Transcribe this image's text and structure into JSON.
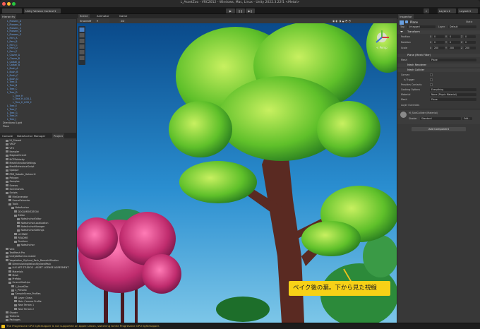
{
  "window": {
    "title": "L_AssetZoo - VRC2012 - Windows, Mac, Linux - Unity 2022.3.22f1 <Metal>"
  },
  "toolbar": {
    "account": "",
    "package": "Unity Version Control",
    "layers": "Layers",
    "layout": "Layout"
  },
  "hierarchy": {
    "tab": "Hierarchy",
    "items": [
      "L_Flowers_A",
      "L_Flowers_B",
      "L_Flowers_C",
      "L_Flowers_D",
      "L_Flowers_E",
      "L_Fern_A",
      "L_Fern_B",
      "L_Fern_C",
      "L_Fern_D",
      "L_Fern_E",
      "L_Clover_A",
      "L_Clover_B",
      "L_Cattail_A",
      "L_Cattail_B",
      "L_Bush_A",
      "L_Bush_B",
      "L_Bush_C",
      "L_Bush_D",
      "L_Tree_A",
      "L_Tree_B",
      "L_Tree_C",
      "L_Tree_D",
      "L_Tree_H",
      "L_Tree_H_LOD_1",
      "L_Tree_H_LOD_2",
      "L_Tree_E",
      "L_Tree_F",
      "L_Tree_G",
      "L_Tree_H",
      "L_Tree_I",
      "Directional Light",
      "Plane"
    ]
  },
  "project": {
    "tabs": [
      "Console",
      "NoteAnchor Manager",
      "Project"
    ],
    "items": [
      "UI_Shared",
      "VRCP",
      "VFX",
      "Kampler",
      "MagicalCircle2",
      "MCPFolderby",
      "MeshExtractorSettings",
      "MeshBehaviourScript",
      "Opaque",
      "PBR_Robotic_Hohenrill",
      "Polygon",
      "Samples",
      "Scenes",
      "Screenshots",
      "Scripts",
      "FileGenerator",
      "SceneExtractor",
      "Tools",
      "NoteAnchor",
      "DOCUMENTATION",
      "Editor",
      "NoteAnchorEditor",
      "NoteAnchorLocalization",
      "NoteAnchorManager",
      "NoteAnchorSettings",
      "LICENSE",
      "README",
      "Runtime",
      "NoteAnchor",
      "Vest",
      "TextMesh Pro",
      "UnityIbIBorkmo reader",
      "Vegetation_Stylized_Pack_BoosehiiStudios",
      "DimensionIngitationStyilseidPack",
      "LUX ART STUDIOS - ASSET LICENSE AGREEMENT",
      "Materials",
      "Mesh",
      "Prefabs",
      "ScreenShotUps",
      "L_AssetZoo",
      "L_Preview",
      "SampleScene_Profiles",
      "Layer_Grass",
      "Main Camera Profile",
      "New Terrain 1",
      "New Terrain 2",
      "Shader",
      "Textures",
      "Packages"
    ]
  },
  "scene": {
    "tabs": [
      "Scene",
      "Animator",
      "Game"
    ],
    "shading": "Shaded",
    "mode": "2D",
    "persp": "< Persp",
    "caption": "ベイク後の葉。下から見た視線"
  },
  "inspector": {
    "tabs": [
      "Inspector"
    ],
    "object_name": "Plane",
    "static": "Static",
    "tag_label": "Tag",
    "tag": "Untagged",
    "layer_label": "Layer",
    "layer": "Default",
    "transform": "Transform",
    "position": [
      "Position",
      "X",
      "0",
      "Y",
      "0",
      "Z",
      "0"
    ],
    "rotation": [
      "Rotation",
      "X",
      "0",
      "Y",
      "0",
      "Z",
      "0"
    ],
    "scale": [
      "Scale",
      "X",
      "200",
      "Y",
      "200",
      "Z",
      "200"
    ],
    "mesh_filter": "Plane (Mesh Filter)",
    "mesh_label": "Mesh",
    "mesh_value": "Plane",
    "mesh_renderer": "Mesh Renderer",
    "mesh_collider": "Mesh Collider",
    "collider_rows": [
      [
        "Convex",
        ""
      ],
      [
        "Is Trigger",
        ""
      ],
      [
        "Provides Contacts",
        ""
      ],
      [
        "Cooking Options",
        "Everything"
      ],
      [
        "Material",
        "None (Physic Material)"
      ],
      [
        "Mesh",
        "Plane"
      ]
    ],
    "layer_overrides": "Layer Overrides",
    "material_name": "M_SkidCollider (Material)",
    "shader_label": "Shader",
    "shader_value": "Standard",
    "edit_label": "Edit...",
    "add_component": "Add Component"
  },
  "status": {
    "message": "The Progressive CPU lightmapper is not supported on Apple silicon, switching to the Progressive GPU lightmapper."
  }
}
